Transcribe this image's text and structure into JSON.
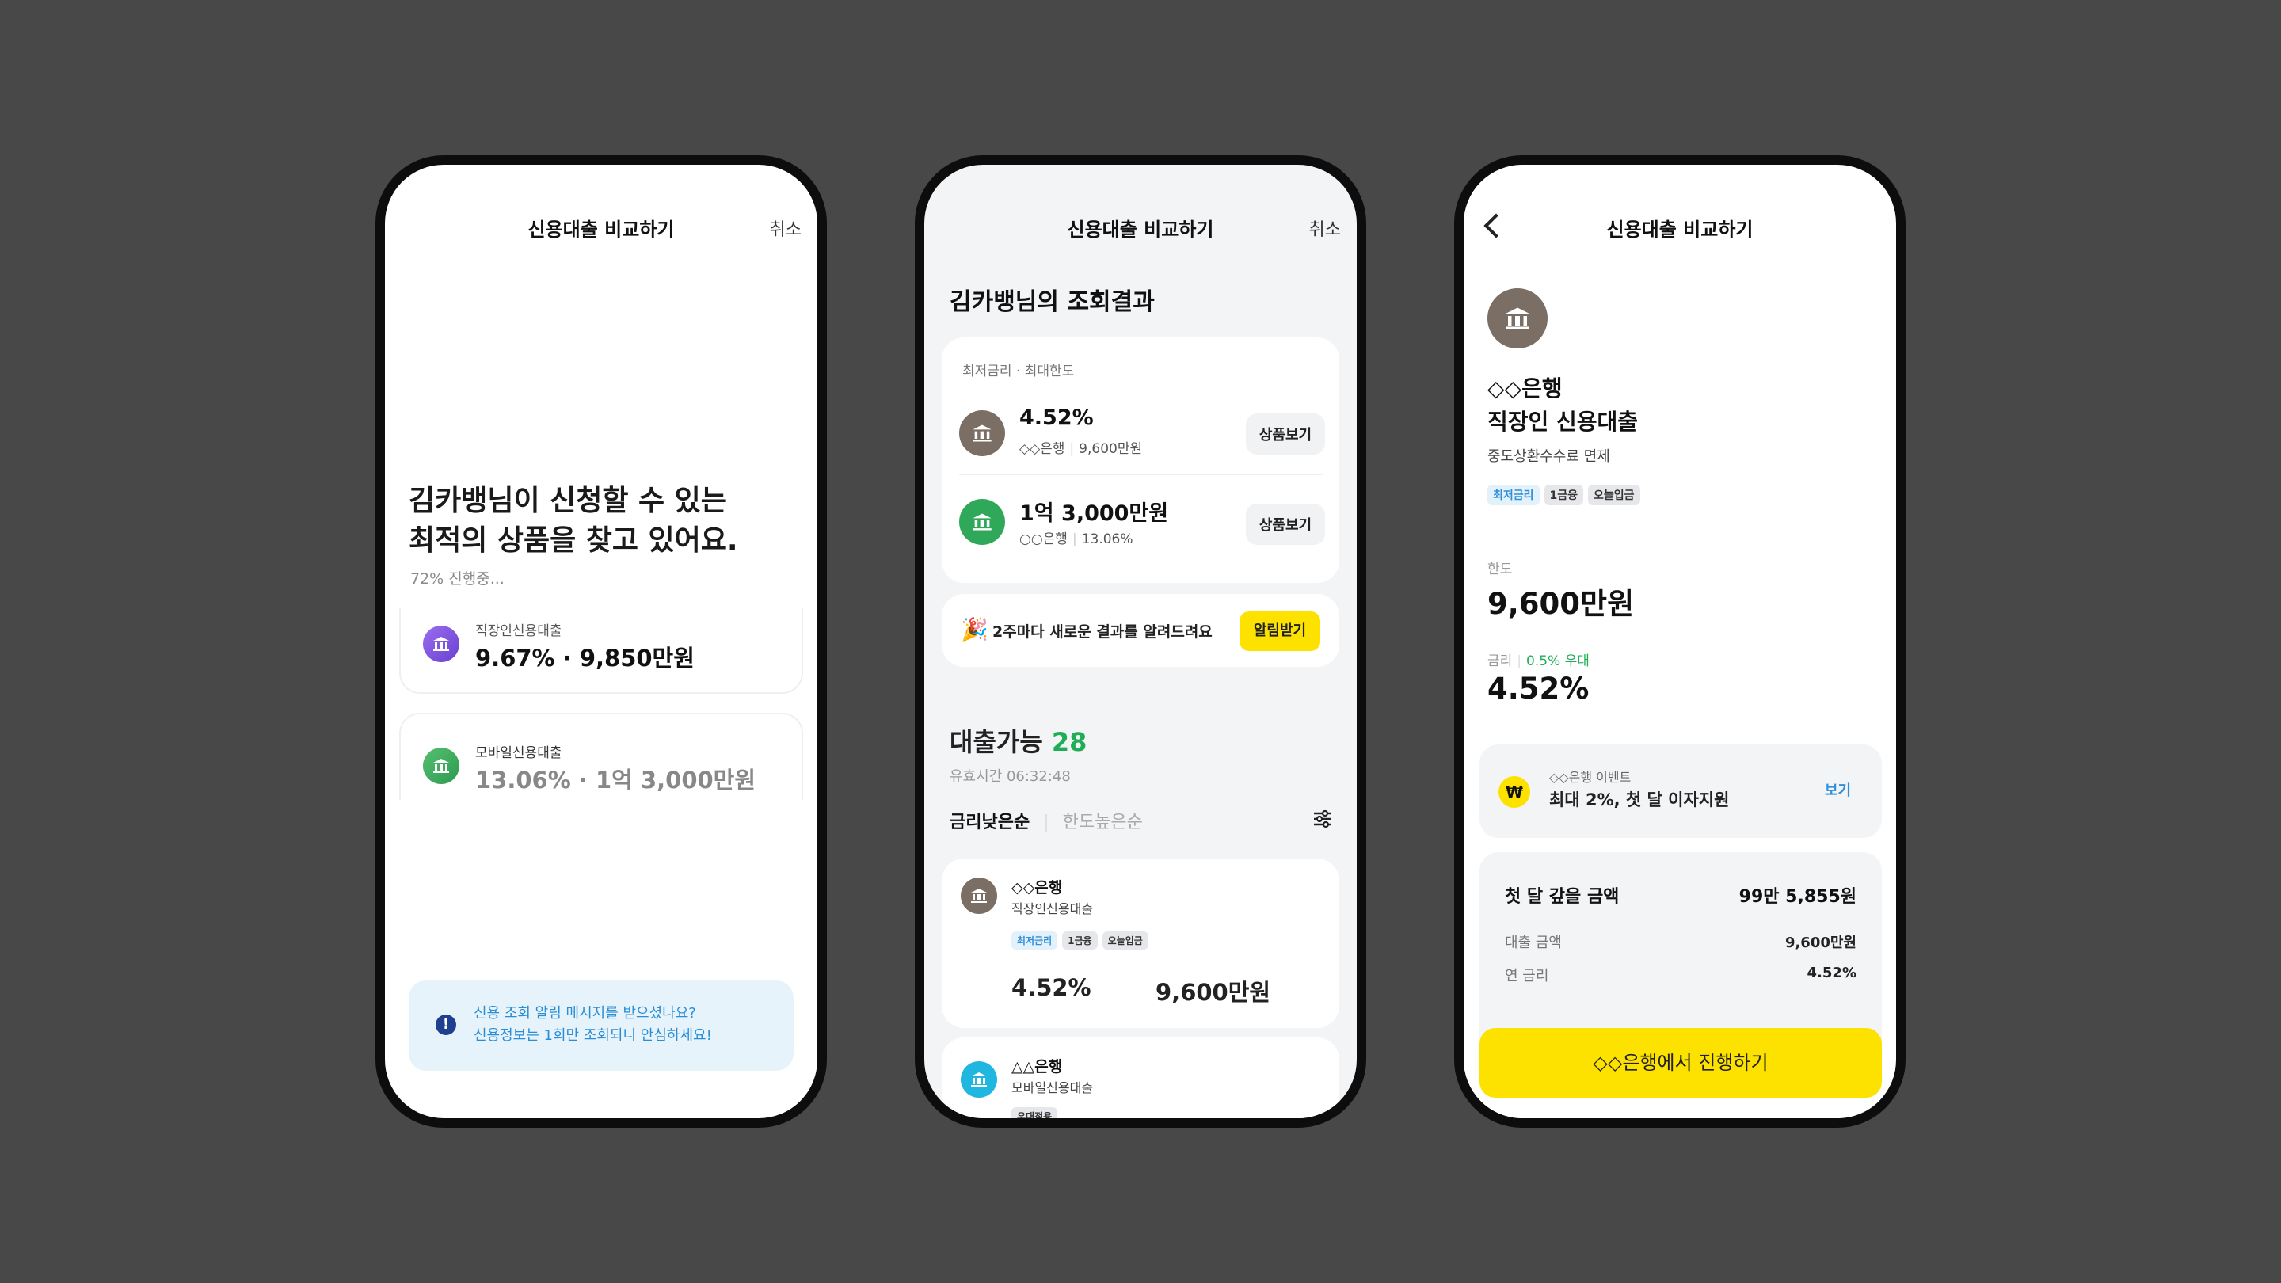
{
  "colors": {
    "background": "#484848",
    "accent_yellow": "#fde200",
    "green": "#1fae57",
    "blue": "#2f8fd8",
    "bank_brown": "#7a6e65",
    "bank_purple": "#7b55d9",
    "bank_green": "#39a85a",
    "bank_cyan": "#1fb6e0"
  },
  "phone1": {
    "title": "신용대출 비교하기",
    "cancel": "취소",
    "headline_line1": "김카뱅님이 신청할 수 있는",
    "headline_line2": "최적의 상품을 찾고 있어요.",
    "progress_text": "72% 진행중...",
    "progress_value": 0.72,
    "cards": [
      {
        "name": "직장인신용대출",
        "value": "9.67% · 9,850만원",
        "icon": "bank-icon"
      },
      {
        "name": "모바일신용대출",
        "value": "13.06% · 1억 3,000만원",
        "icon": "bank-icon"
      }
    ],
    "notice_line1": "신용 조회 알림 메시지를 받으셨나요?",
    "notice_line2": "신용정보는 1회만 조회되니 안심하세요!"
  },
  "phone2": {
    "title": "신용대출 비교하기",
    "cancel": "취소",
    "result_title": "김카뱅님의 조회결과",
    "summary_label": "최저금리 · 최대한도",
    "summary_items": [
      {
        "main": "4.52%",
        "bank": "◇◇은행",
        "sub": "9,600만원",
        "button": "상품보기"
      },
      {
        "main": "1억 3,000만원",
        "bank": "○○은행",
        "sub": "13.06%",
        "button": "상품보기"
      }
    ],
    "alert_text": "2주마다 새로운 결과를 알려드려요",
    "alert_button": "알림받기",
    "available_label": "대출가능",
    "available_count": "28",
    "valid_time": "유효시간 06:32:48",
    "sort_active": "금리낮은순",
    "sort_inactive": "한도높은순",
    "list": [
      {
        "bank": "◇◇은행",
        "product": "직장인신용대출",
        "tags": [
          "최저금리",
          "1금융",
          "오늘입금"
        ],
        "rate": "4.52%",
        "limit": "9,600만원"
      },
      {
        "bank": "△△은행",
        "product": "모바일신용대출",
        "tags": [
          "우대적용"
        ]
      }
    ]
  },
  "phone3": {
    "title": "신용대출 비교하기",
    "bank_name": "◇◇은행",
    "product_name": "직장인 신용대출",
    "fee_note": "중도상환수수료 면제",
    "tags": [
      "최저금리",
      "1금융",
      "오늘입금"
    ],
    "limit_label": "한도",
    "limit_value": "9,600만원",
    "rate_label": "금리",
    "rate_discount": "0.5% 우대",
    "rate_value": "4.52%",
    "event_label": "◇◇은행 이벤트",
    "event_text": "최대 2%, 첫 달 이자지원",
    "event_button": "보기",
    "first_month_label": "첫 달 갚을 금액",
    "first_month_value": "99만 5,855원",
    "rows": [
      {
        "label": "대출 금액",
        "value": "9,600만원"
      },
      {
        "label": "연 금리",
        "value": "4.52%"
      }
    ],
    "cta": "◇◇은행에서 진행하기"
  }
}
